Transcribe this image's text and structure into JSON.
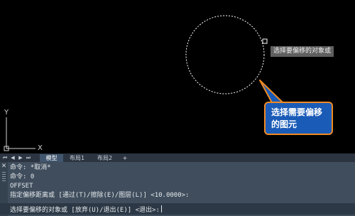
{
  "canvas": {
    "tooltip": "选择要偏移的对象或",
    "callout_line1": "选择需要偏移",
    "callout_line2": "的图元",
    "ucs_y": "Y",
    "ucs_x": "X",
    "colors": {
      "background": "#000000",
      "circle": "#ffffff",
      "callout_fill": "#1a5bb8",
      "callout_border": "#f08a24"
    }
  },
  "tabs": {
    "nav_icons": [
      "first-layout-icon",
      "prev-layout-icon",
      "next-layout-icon",
      "last-layout-icon"
    ],
    "items": [
      "模型",
      "布局1",
      "布局2",
      "+"
    ],
    "active": "模型"
  },
  "command": {
    "history": [
      "命令: *取消*",
      "命令: 0",
      "OFFSET",
      "指定偏移距离或 [通过(T)/擦除(E)/图层(L)] <10.0000>:"
    ],
    "prompt": "选择要偏移的对象或 [放弃(U)/退出(E)] <退出>:"
  }
}
